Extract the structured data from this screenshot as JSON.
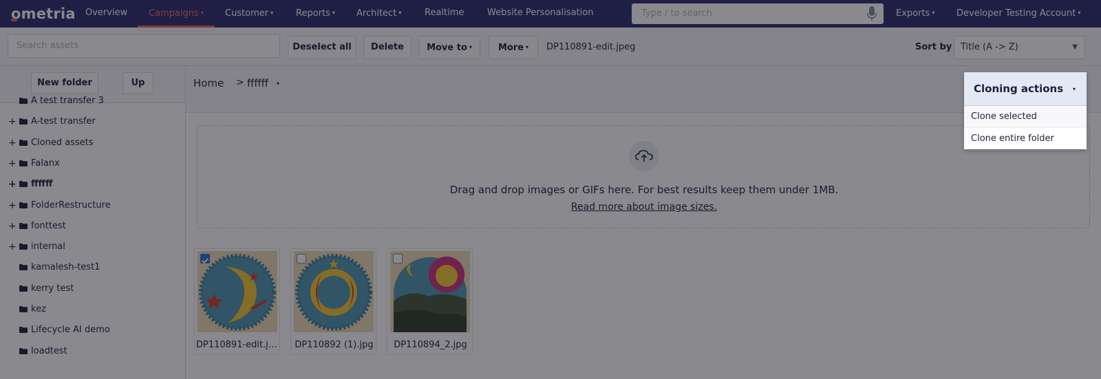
{
  "nav": {
    "logo": "ometria",
    "items": [
      {
        "label": "Overview",
        "caret": ""
      },
      {
        "label": "Campaigns",
        "caret": "▾"
      },
      {
        "label": "Customer",
        "caret": "▾"
      },
      {
        "label": "Reports",
        "caret": "▾"
      },
      {
        "label": "Architect",
        "caret": "▾"
      },
      {
        "label": "Realtime",
        "caret": ""
      },
      {
        "label": "Website Personalisation",
        "caret": ""
      }
    ],
    "search_placeholder": "Type / to search",
    "exports": "Exports",
    "account": "Developer Testing Account",
    "caret": "▾",
    "accent": "#e85a5a",
    "bar_color": "#2a2a6e"
  },
  "toolbar": {
    "search_placeholder": "Search assets",
    "deselect_all": "Deselect all",
    "delete": "Delete",
    "move_to": "Move to",
    "more": "More",
    "caret": "▾",
    "selected_file": "DP110891-edit.jpeg",
    "sort_label": "Sort by",
    "sort_value": "Title (A -> Z)",
    "sort_arrow": "▼"
  },
  "sidebar": {
    "new_folder": "New folder",
    "up": "Up",
    "folders": [
      {
        "label": "A test transfer 3",
        "expand": ""
      },
      {
        "label": "A-test transfer",
        "expand": "+"
      },
      {
        "label": "Cloned assets",
        "expand": "+"
      },
      {
        "label": "Falanx",
        "expand": "+"
      },
      {
        "label": "ffffff",
        "expand": "+"
      },
      {
        "label": "FolderRestructure",
        "expand": "+"
      },
      {
        "label": "fonttest",
        "expand": "+"
      },
      {
        "label": "internal",
        "expand": "+"
      },
      {
        "label": "kamalesh-test1",
        "expand": ""
      },
      {
        "label": "kerry test",
        "expand": ""
      },
      {
        "label": "kez",
        "expand": ""
      },
      {
        "label": "Lifecycle AI demo",
        "expand": ""
      },
      {
        "label": "loadtest",
        "expand": ""
      }
    ]
  },
  "breadcrumb": {
    "home": "Home",
    "separator": ">",
    "current": "ffffff",
    "caret": "▾"
  },
  "dropzone": {
    "text": "Drag and drop images or GIFs here. For best results keep them under 1MB.",
    "link": "Read more about image sizes."
  },
  "assets": [
    {
      "name": "DP110891-edit.jpeg",
      "checked": true
    },
    {
      "name": "DP110892 (1).jpg",
      "checked": false
    },
    {
      "name": "DP110894_2.jpg",
      "checked": false
    }
  ],
  "cloning": {
    "title": "Cloning actions",
    "caret": "▾",
    "items": [
      "Clone selected",
      "Clone entire folder"
    ]
  },
  "icons": {
    "check": "✓"
  }
}
